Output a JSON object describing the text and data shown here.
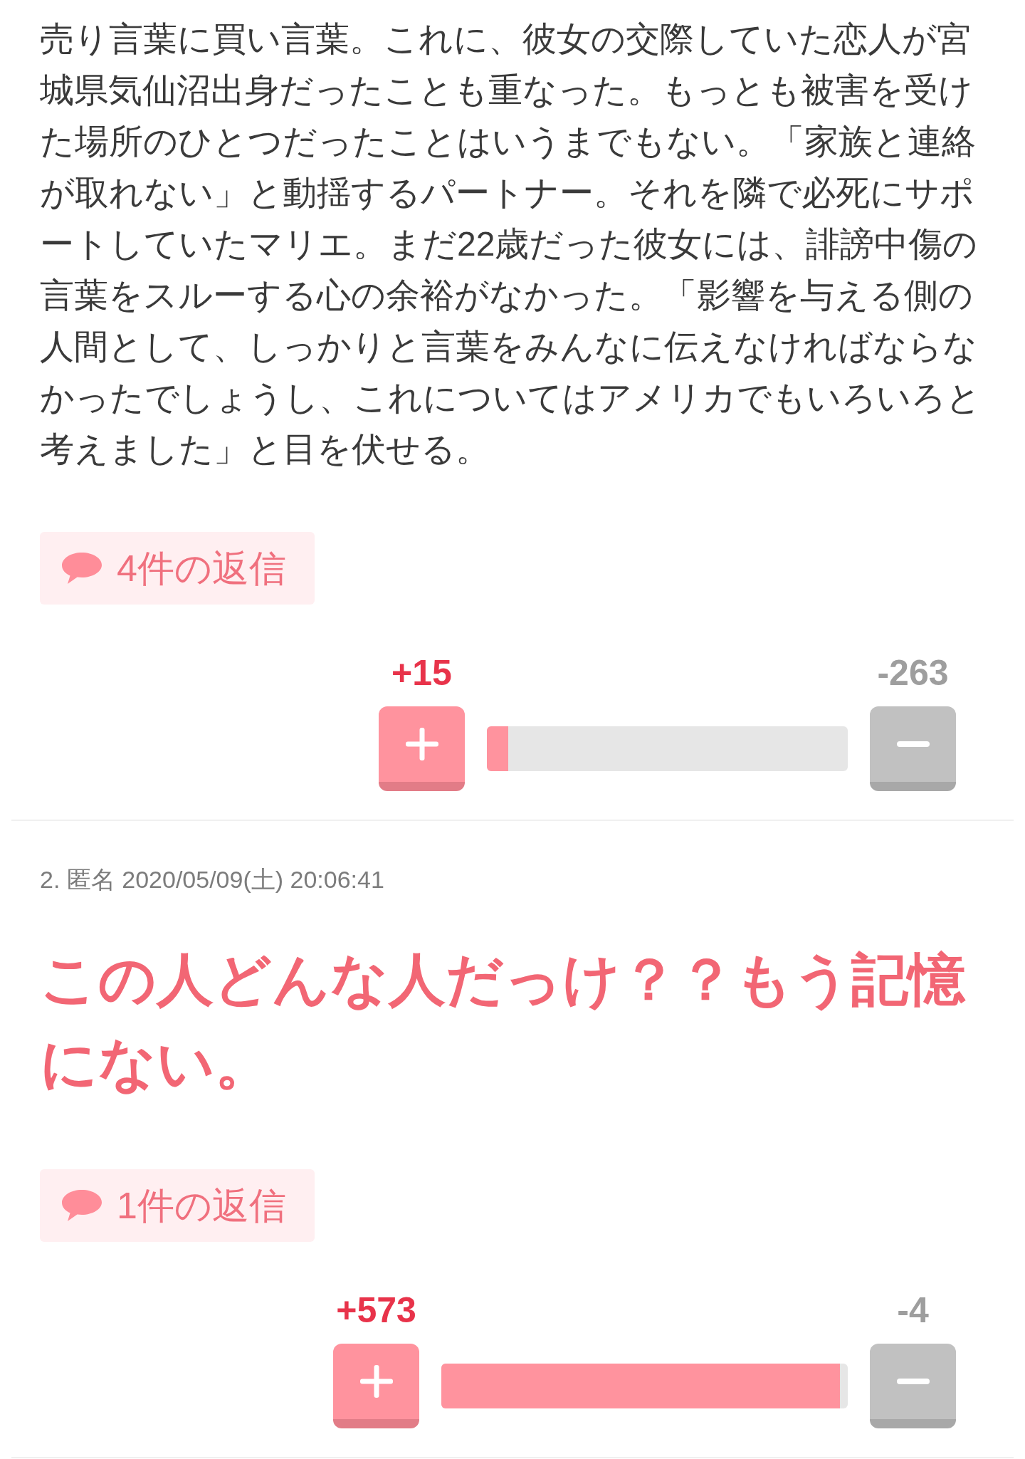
{
  "comments": [
    {
      "kind": "normal",
      "body": "売り言葉に買い言葉。これに、彼女の交際していた恋人が宮城県気仙沼出身だったことも重なった。もっとも被害を受けた場所のひとつだったことはいうまでもない。「家族と連絡が取れない」と動揺するパートナー。それを隣で必死にサポートしていたマリエ。まだ22歳だった彼女には、誹謗中傷の言葉をスルーする心の余裕がなかった。「影響を与える側の人間として、しっかりと言葉をみんなに伝えなければならなかったでしょうし、これについてはアメリカでもいろいろと考えました」と目を伏せる。",
      "replies": "4件の返信",
      "votes": {
        "up": "+15",
        "down": "-263",
        "level": 0.06
      }
    },
    {
      "kind": "popular",
      "header": "2. 匿名 2020/05/09(土) 20:06:41",
      "body": "この人どんな人だっけ？？もう記憶にない。",
      "replies": "1件の返信",
      "votes": {
        "up": "+573",
        "down": "-4",
        "level": 0.98
      }
    }
  ]
}
